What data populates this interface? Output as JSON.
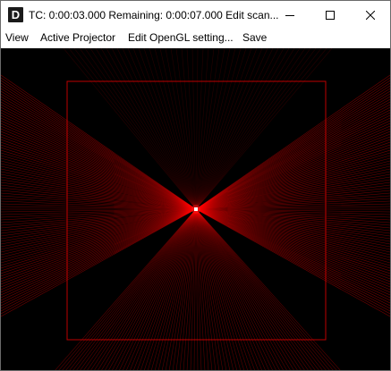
{
  "window": {
    "title": "TC: 0:00:03.000  Remaining: 0:00:07.000  Edit scan...",
    "app_icon_letter": "D"
  },
  "menu": {
    "items": [
      "View",
      "Active Projector",
      "Edit OpenGL setting...",
      "Save"
    ]
  },
  "viewport": {
    "background_color": "#000000",
    "beam_color": "#ff0000",
    "center_dot_color": "#ffffff"
  }
}
